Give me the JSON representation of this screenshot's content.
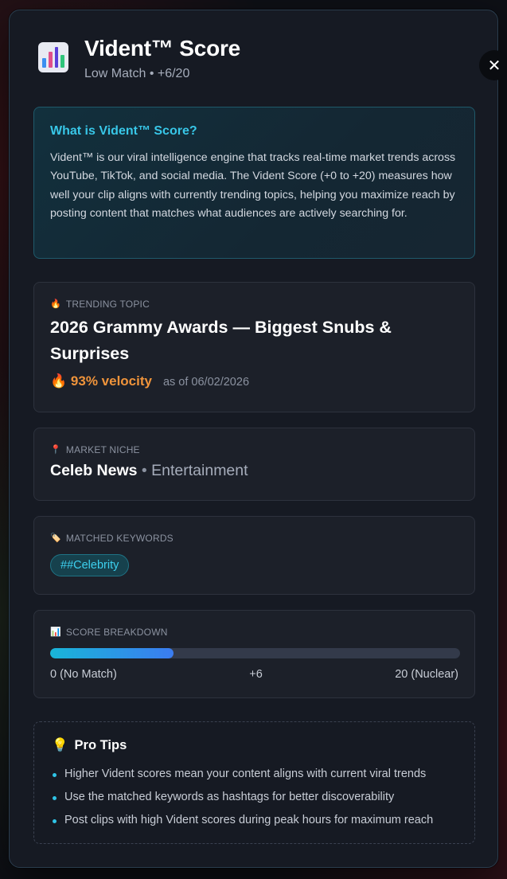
{
  "header": {
    "title": "Vident™ Score",
    "subtitle": "Low Match • +6/20",
    "close_label": "✕",
    "icon": "bar-chart-icon"
  },
  "info": {
    "title": "What is Vident™ Score?",
    "body": "Vident™ is our viral intelligence engine that tracks real-time market trends across YouTube, TikTok, and social media. The Vident Score (+0 to +20) measures how well your clip aligns with currently trending topics, helping you maximize reach by posting content that matches what audiences are actively searching for."
  },
  "trending": {
    "label": "TRENDING TOPIC",
    "label_icon": "fire-icon",
    "title": "2026 Grammy Awards — Biggest Snubs & Surprises",
    "velocity": "93% velocity",
    "velocity_icon": "fire-icon",
    "as_of": "as of 06/02/2026"
  },
  "niche": {
    "label": "MARKET NICHE",
    "label_icon": "pin-icon",
    "main": "Celeb News",
    "separator": "•",
    "sub": "Entertainment"
  },
  "keywords": {
    "label": "MATCHED KEYWORDS",
    "label_icon": "tag-icon",
    "items": [
      "##Celebrity"
    ]
  },
  "breakdown": {
    "label": "SCORE BREAKDOWN",
    "label_icon": "bar-chart-icon",
    "score": 6,
    "max": 20,
    "min_label": "0 (No Match)",
    "value_label": "+6",
    "max_label": "20 (Nuclear)"
  },
  "tips": {
    "title": "Pro Tips",
    "icon": "lightbulb-icon",
    "items": [
      "Higher Vident scores mean your content aligns with current viral trends",
      "Use the matched keywords as hashtags for better discoverability",
      "Post clips with high Vident scores during peak hours for maximum reach"
    ]
  },
  "colors": {
    "accent": "#38c7e8",
    "velocity": "#f0943b",
    "bar_start": "#19b5d8",
    "bar_end": "#3b7cf0"
  }
}
